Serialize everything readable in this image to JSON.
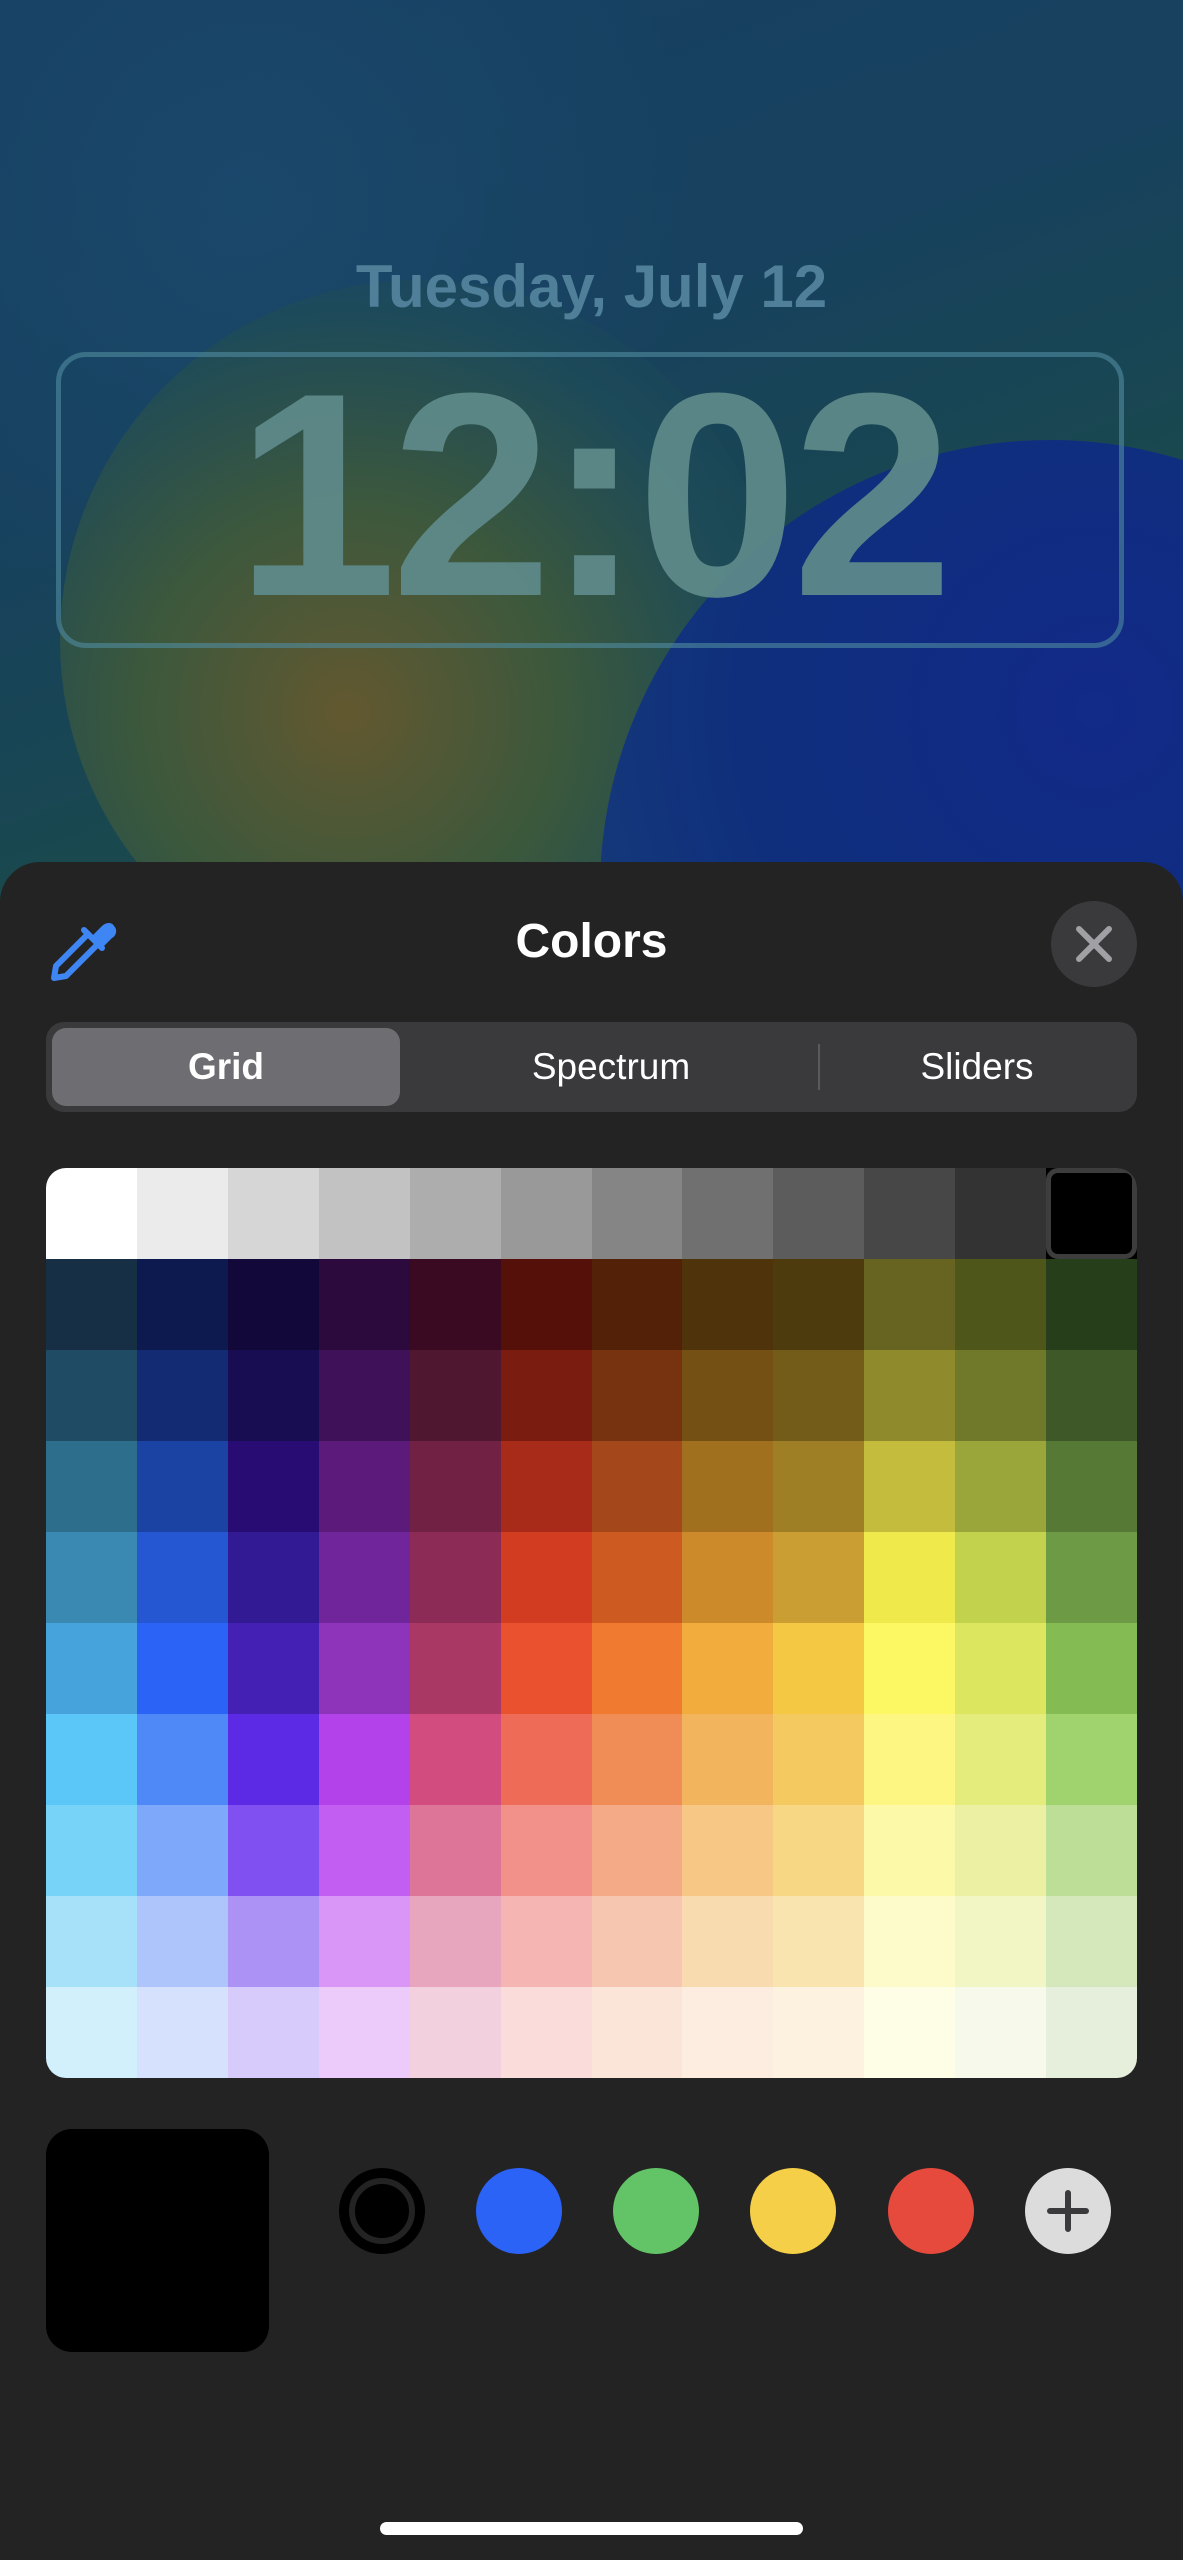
{
  "lock_screen": {
    "date": "Tuesday, July 12",
    "time": "12:02"
  },
  "sheet": {
    "title": "Colors",
    "eyedropper_icon": "eyedropper-icon",
    "close_icon": "close-icon"
  },
  "tabs": [
    {
      "label": "Grid",
      "active": true
    },
    {
      "label": "Spectrum",
      "active": false
    },
    {
      "label": "Sliders",
      "active": false
    }
  ],
  "grid": {
    "columns": 12,
    "rows": 10,
    "selected": {
      "row": 0,
      "col": 11
    },
    "colors": [
      [
        "#ffffff",
        "#ebebeb",
        "#d6d6d6",
        "#c2c2c2",
        "#adadad",
        "#999999",
        "#858585",
        "#707070",
        "#5c5c5c",
        "#474747",
        "#333333",
        "#000000"
      ],
      [
        "#172f45",
        "#0d1a4f",
        "#12083a",
        "#2c0a3e",
        "#3a0a22",
        "#551109",
        "#522108",
        "#4f330b",
        "#4e3b0d",
        "#676320",
        "#4f5619",
        "#263e1a"
      ],
      [
        "#1f4c64",
        "#122b73",
        "#180d53",
        "#3f1158",
        "#501731",
        "#7a1c10",
        "#77320f",
        "#755015",
        "#735b19",
        "#8f8a2b",
        "#6f7929",
        "#3e5927"
      ],
      [
        "#2e6e8d",
        "#1b43a3",
        "#280c74",
        "#5c1a7b",
        "#712144",
        "#a82a19",
        "#a4471a",
        "#a1701f",
        "#9f7f26",
        "#c3bc3c",
        "#9aa53a",
        "#567a36"
      ],
      [
        "#3a89b3",
        "#2657d3",
        "#311a94",
        "#70269a",
        "#8c2b55",
        "#d23c21",
        "#cd5a21",
        "#cc8a2b",
        "#cb9e33",
        "#f0e94c",
        "#c3d24d",
        "#6d9a44"
      ],
      [
        "#46a3dc",
        "#2b63f7",
        "#4520b5",
        "#8d34bb",
        "#a93865",
        "#e9512f",
        "#f07a2f",
        "#f2ac3e",
        "#f4c843",
        "#fcf863",
        "#dce75f",
        "#84bb53"
      ],
      [
        "#5bc7f8",
        "#4f89f8",
        "#5c2ae5",
        "#b342ea",
        "#d34c80",
        "#ed6b57",
        "#f08c55",
        "#f3b45e",
        "#f4c95f",
        "#fdf683",
        "#e4ec7b",
        "#a0d26d"
      ],
      [
        "#77d3f7",
        "#7ea8f9",
        "#8150f0",
        "#c35ef2",
        "#dd7598",
        "#f1918a",
        "#f4a987",
        "#f6c785",
        "#f7d784",
        "#fcf9a8",
        "#ebf0a2",
        "#bdde97"
      ],
      [
        "#a6e0f9",
        "#adc5fb",
        "#ab92f4",
        "#d996f6",
        "#e8a5be",
        "#f5b5b2",
        "#f7c6b0",
        "#f8dcb0",
        "#f9e4b0",
        "#fdfbca",
        "#f2f6c4",
        "#d4e8bc"
      ],
      [
        "#d1f0fc",
        "#d6e2fd",
        "#d6cbfa",
        "#eccbfb",
        "#f3d0de",
        "#fadcda",
        "#fbe4d8",
        "#fcede0",
        "#fcf2df",
        "#fefde6",
        "#f7faea",
        "#e5efdc"
      ]
    ]
  },
  "current_color": "#000000",
  "favorites": [
    {
      "name": "black",
      "color": "#000000",
      "selected": true
    },
    {
      "name": "blue",
      "color": "#2b63f7",
      "selected": false
    },
    {
      "name": "green",
      "color": "#62c466",
      "selected": false
    },
    {
      "name": "yellow",
      "color": "#f5cf47",
      "selected": false
    },
    {
      "name": "red",
      "color": "#e64a3c",
      "selected": false
    }
  ],
  "add_favorite_icon": "plus-icon"
}
